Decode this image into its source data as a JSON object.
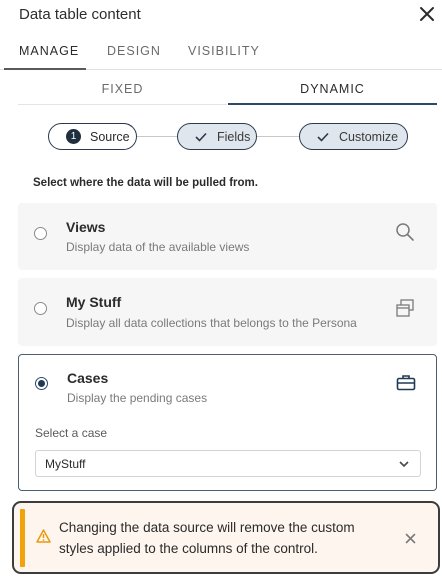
{
  "header": {
    "title": "Data table content"
  },
  "tabs": [
    {
      "label": "MANAGE",
      "active": true
    },
    {
      "label": "DESIGN",
      "active": false
    },
    {
      "label": "VISIBILITY",
      "active": false
    }
  ],
  "subtabs": [
    {
      "label": "FIXED",
      "active": false
    },
    {
      "label": "DYNAMIC",
      "active": true
    }
  ],
  "stepper": [
    {
      "number": "1",
      "label": "Source",
      "state": "current"
    },
    {
      "label": "Fields",
      "state": "completed"
    },
    {
      "label": "Customize",
      "state": "completed"
    }
  ],
  "instruction": "Select where the data will be pulled from.",
  "sources": [
    {
      "title": "Views",
      "description": "Display data of the available views",
      "icon": "search-icon",
      "selected": false
    },
    {
      "title": "My Stuff",
      "description": "Display all data collections that belongs to the Persona",
      "icon": "stacked-windows-icon",
      "selected": false
    },
    {
      "title": "Cases",
      "description": "Display the pending cases",
      "icon": "briefcase-icon",
      "selected": true
    }
  ],
  "case_select": {
    "label": "Select a case",
    "value": "MyStuff"
  },
  "warning": {
    "message": "Changing the data source will remove the custom styles applied to the columns of the control.",
    "accent": "#f0a30a"
  },
  "colors": {
    "primary": "#1f3a55",
    "step_fill": "#dfe6ee",
    "warning_bg": "#fdf5ee"
  }
}
